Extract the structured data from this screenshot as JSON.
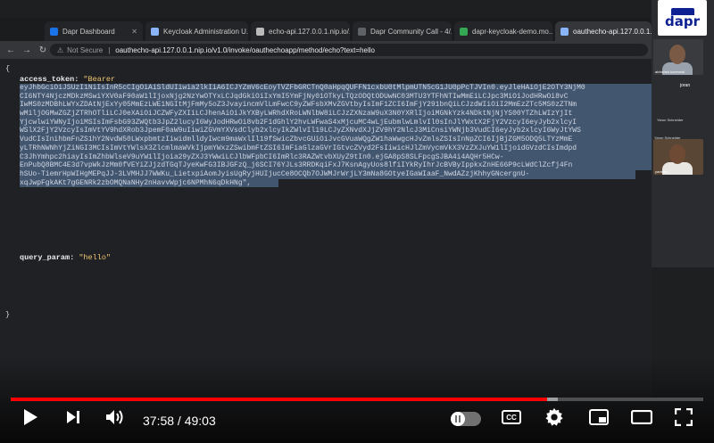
{
  "browser": {
    "tabs": [
      {
        "label": "Dapr Dashboard",
        "favicon_color": "#1a73e8",
        "active": false
      },
      {
        "label": "Keycloak Administration U...",
        "favicon_color": "#8ab4f8",
        "active": false
      },
      {
        "label": "echo-api.127.0.0.1.nip.io/...",
        "favicon_color": "#bbbbbb",
        "active": false
      },
      {
        "label": "Dapr Community Call - 4/...",
        "favicon_color": "#5f6368",
        "active": false
      },
      {
        "label": "dapr-keycloak-demo.mo...",
        "favicon_color": "#34a853",
        "active": false
      },
      {
        "label": "oauthecho-api.127.0.0.1...",
        "favicon_color": "#8ab4f8",
        "active": true
      }
    ],
    "address": {
      "security_label": "Not Secure",
      "url": "oauthecho-api.127.0.0.1.nip.io/v1.0/invoke/oauthechoapp/method/echo?text=hello"
    }
  },
  "json_view": {
    "open_brace": "{",
    "close_brace": "}",
    "access_token_key": "access_token:",
    "access_token_prefix": "\"Bearer",
    "token_lines": [
      "eyJhbGciOiJSUzI1NiIsInR5cCIgOiAiSldUIiwia2lkIiA6ICJYZmV6cEoyTVZFbGRCTnQ0aHpqQUFFN1cxbU0tMlpmUTN5cG1JU0pPcTJVIn0.eyJleHAiOjE2OTY3NjM0",
      "CI6NTY4NjczMDkzMSwiYXV0aF90aW1lIjoxNjg2NzYwOTYxLCJqdGkiOiIxYmI5YmFjNy01OTkyLTQzODQtODUwNC03MTU3YTFhNTIwMmEiLCJpc3MiOiJodHRwOi8vC",
      "IwMS0zMDBhLWYxZDAtNjExYy05MmEzLWE1NGItMjFmMy5oZ3JvayincmVlLmFwcC9yZWFsbXMvZGVtbyIsImF1ZCI6ImFjY291bnQiLCJzdWIiOiI2MmEzZTc5MS0zZTNm",
      "wMiljOGMwZGZjZTRhOTliLCJ0eXAiOiJCZWFyZXIiLCJhenAiOiJkYXByLWRhdXRoLWNlbW8iLCJzZXNzaW9uX3N0YXRlIjoiMGNkYzk4NDktNjNjYS00YTZhLWIzYjIt",
      "YjcwlwiYWNyIjoiMSIsImFsbG93ZWQtb3JpZ2lucyI6WyJodHRwOi8vb2F1dGhlY2hvLWFwaS4xMjcuMC4wLjEubmlwLmlvIl0sInJlYWxtX2FjY2VzcyI6eyJyb2xlcyI",
      "WSlX2FjY2VzcyIsImVtYV9hdXRob3JpemF0aW9uIiwiZGVmYXVsdClyb2xlcyIkZWlvIl19LCJyZXNvdXJjZV9hY2NlcJ3MiCnsiYWNjb3VudCI6eyJyb2xlcyI6WyJtYWS",
      "VudCIsInihbmFnZS1hY2NvdW50LWxpbmtzIiwidmlldyIwcm9maWxlIl19fSwicZbvcGUiOiJvcGVuaWQgZW1haWwgcHJvZmlsZSIsInNpZCI6IjBjZGM5ODQ5LTYzMmE",
      "yLTRhNWNhYjZiNGI3MCIsImVtYWlsX3ZlcmlmaWVkIjpmYWxzZSwibmFtZSI6ImFiaGlzaGVrIGtvcZVyd2FsIiwicHJlZmVycmVkX3VzZXJuYW1lIjoidGVzdCIsImdpd",
      "C3JhYmhpc2hiayIsImZhbWlseV9uYW1lIjoia29yZXJ3YWwiLCJlbWFpbCI6ImRlc3RAZWtvbXUyZ9tIn0.ejGA8pS8SLFpcgSJBA4i4AQHr5HCw-",
      "EnPubQ8BMC4E3d7vpWkJzMm0fVEYiZJjzdTGqTJyeKwFG3IBJGFzQ_j6SCI76YJLs3RRDKqiFxJ7KsnAgyUos8lfiIYkRyIhrJcBVByIppkxZnHE66P9cLWdClZcfj4Fn",
      "hSUo-TiemrHpWIHgMEPqJJ-3LVMHJJ7WWKu_LietxpiAomJyisUgRyjHUIjucCe8OCQb7OJWMJrWrjLY3mNa8GOtyeIGaWIaaF_NwdAZzjKhhyGNcergnU-",
      "xqJwpFgkAKt7gGENRk2zbOMQNaNHy2nHavvWpjc6NPMhN6qDkHNg\","
    ],
    "query_param_key": "query_param:",
    "query_param_value": "\"hello\""
  },
  "video_call": {
    "logo_text": "dapr",
    "participants": [
      {
        "name": "abhishek.korenwal"
      },
      {
        "name": "joran"
      },
      {
        "name": "Yaron Schneider"
      },
      {
        "name": "Yaron Schneider"
      },
      {
        "name": "yaninan"
      }
    ]
  },
  "player": {
    "current_time": "37:58",
    "separator": " / ",
    "duration": "49:03",
    "progress_played": 0.774,
    "progress_loaded": 0.79,
    "autoplay_on": false,
    "cc_label": "CC",
    "colors": {
      "played": "#ff0000"
    }
  }
}
